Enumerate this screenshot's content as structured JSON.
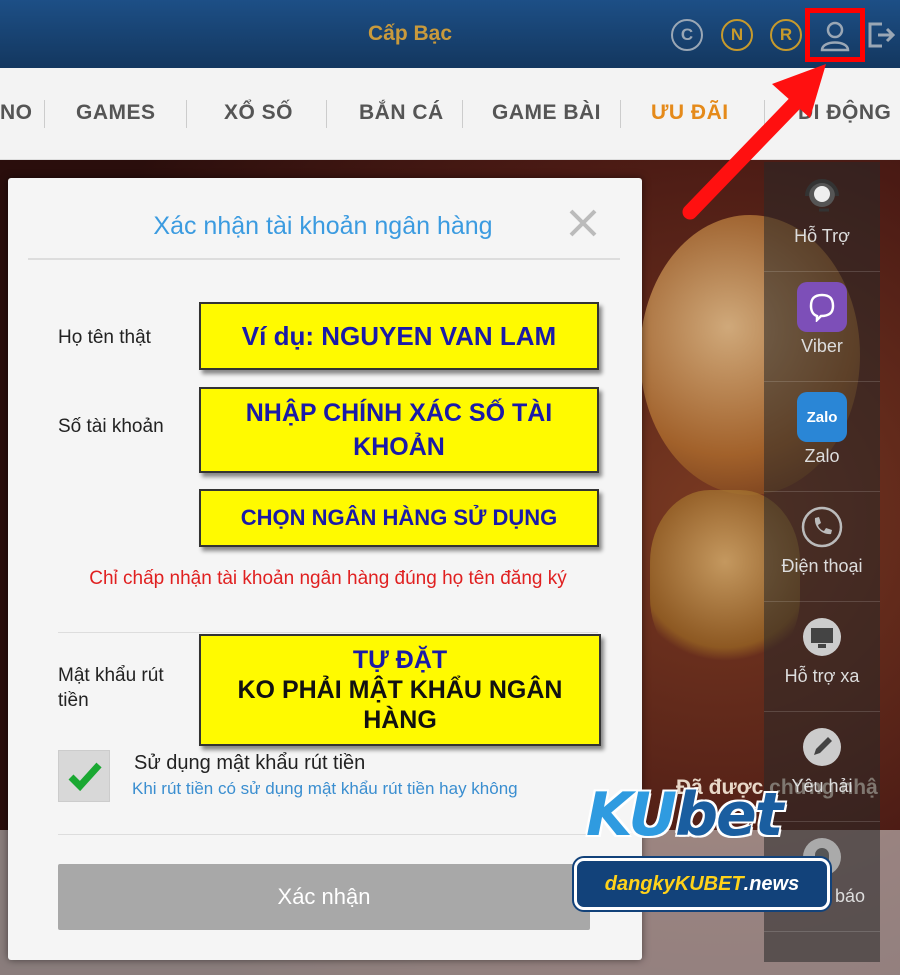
{
  "topbar": {
    "level": "Cấp Bạc",
    "coins": [
      "C",
      "N",
      "R"
    ]
  },
  "nav": {
    "items": [
      "NO",
      "GAMES",
      "XỔ SỐ",
      "BẮN CÁ",
      "GAME BÀI",
      "ƯU ĐÃI",
      "DI ĐỘNG"
    ],
    "active": "ƯU ĐÃI"
  },
  "side": {
    "items": [
      "Hỗ Trợ",
      "Viber",
      "Zalo",
      "Điện thoại",
      "Hỗ trợ xa",
      "Yêu hải",
      "Thông báo"
    ],
    "zalo_glyph": "Zalo"
  },
  "background": {
    "banner": "Đã được chứng nhậ"
  },
  "dialog": {
    "title": "Xác nhận tài khoản ngân hàng",
    "name_label": "Họ tên thật",
    "name_hint": "Ví dụ: NGUYEN VAN LAM",
    "account_label": "Số tài khoản",
    "account_hint": "NHẬP CHÍNH XÁC SỐ TÀI KHOẢN",
    "bank_hint": "CHỌN NGÂN HÀNG SỬ DỤNG",
    "warning": "Chỉ chấp nhận tài khoản ngân hàng đúng họ tên đăng ký",
    "password_label": "Mật khẩu rút tiền",
    "password_hint_1": "TỰ ĐẶT",
    "password_hint_2": "KO PHẢI MẬT KHẨU NGÂN HÀNG",
    "use_password_label": "Sử dụng mật khẩu rút tiền",
    "use_password_sub": "Khi rút tiền có sử dụng mật khẩu rút tiền hay không",
    "use_password_checked": true,
    "confirm_label": "Xác nhận"
  },
  "watermark": {
    "brand_ku": "KU",
    "brand_bet": "bet",
    "site_a": "dangkyKUBET",
    "site_b": ".news"
  },
  "colors": {
    "accent": "#3b9be0",
    "warning": "#e02020",
    "highlight": "#fffa00",
    "annotation": "#ff0000"
  }
}
